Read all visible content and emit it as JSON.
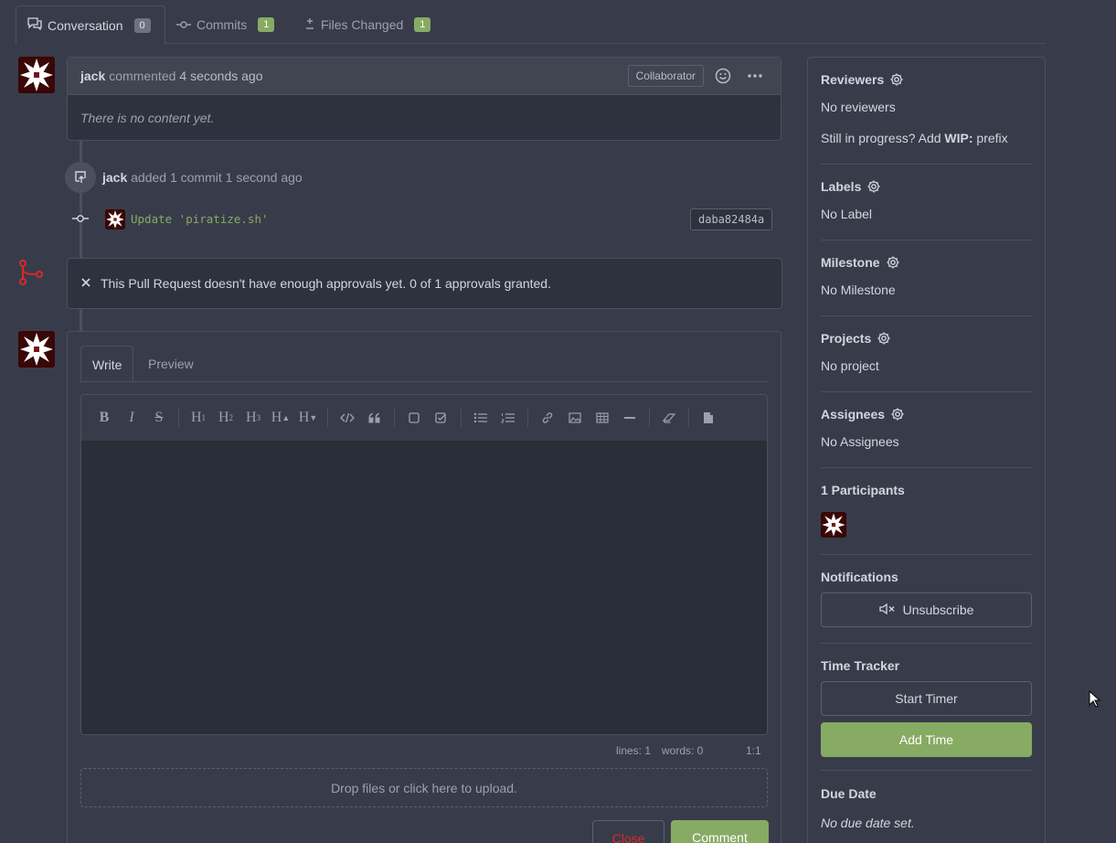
{
  "tabs": [
    {
      "label": "Conversation",
      "count": "0"
    },
    {
      "label": "Commits",
      "count": "1"
    },
    {
      "label": "Files Changed",
      "count": "1"
    }
  ],
  "comment": {
    "author": "jack",
    "action": "commented",
    "time": "4 seconds ago",
    "role": "Collaborator",
    "body": "There is no content yet."
  },
  "commit_event": {
    "author": "jack",
    "text": "added 1 commit 1 second ago",
    "message": "Update 'piratize.sh'",
    "sha": "daba82484a"
  },
  "merge": {
    "text": "This Pull Request doesn't have enough approvals yet. 0 of 1 approvals granted."
  },
  "editor": {
    "tab_write": "Write",
    "tab_preview": "Preview",
    "lines": "lines: 1",
    "words": "words: 0",
    "cursor": "1:1",
    "dropzone": "Drop files or click here to upload.",
    "close_label": "Close",
    "comment_label": "Comment"
  },
  "sidebar": {
    "reviewers_title": "Reviewers",
    "reviewers_value": "No reviewers",
    "wip_prefix": "Still in progress? Add ",
    "wip_bold": "WIP:",
    "wip_suffix": " prefix",
    "labels_title": "Labels",
    "labels_value": "No Label",
    "milestone_title": "Milestone",
    "milestone_value": "No Milestone",
    "projects_title": "Projects",
    "projects_value": "No project",
    "assignees_title": "Assignees",
    "assignees_value": "No Assignees",
    "participants_title": "1 Participants",
    "notifications_title": "Notifications",
    "unsubscribe_label": "Unsubscribe",
    "time_tracker_title": "Time Tracker",
    "start_timer_label": "Start Timer",
    "add_time_label": "Add Time",
    "due_date_title": "Due Date",
    "due_date_value": "No due date set."
  },
  "colors": {
    "accent_green": "#87ab63",
    "danger_red": "#db2828",
    "background": "#383c4a"
  }
}
